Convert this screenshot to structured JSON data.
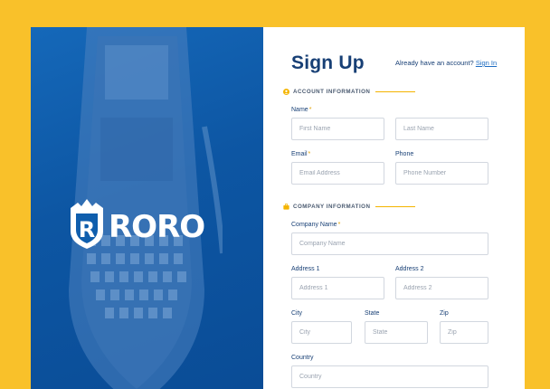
{
  "brand": {
    "name": "RORO"
  },
  "header": {
    "title": "Sign Up",
    "signin_prompt": "Already have an account?",
    "signin_link": "Sign In"
  },
  "sections": {
    "account": {
      "title": "ACCOUNT INFORMATION",
      "icon": "user-circle-icon"
    },
    "company": {
      "title": "COMPANY INFORMATION",
      "icon": "briefcase-icon"
    }
  },
  "fields": {
    "name": {
      "label": "Name",
      "required_mark": "*",
      "first_placeholder": "First Name",
      "last_placeholder": "Last Name"
    },
    "email": {
      "label": "Email",
      "required_mark": "*",
      "placeholder": "Email Address"
    },
    "phone": {
      "label": "Phone",
      "placeholder": "Phone Number"
    },
    "company_name": {
      "label": "Company Name",
      "required_mark": "*",
      "placeholder": "Company Name"
    },
    "address1": {
      "label": "Address 1",
      "placeholder": "Address 1"
    },
    "address2": {
      "label": "Address 2",
      "placeholder": "Address 2"
    },
    "city": {
      "label": "City",
      "placeholder": "City"
    },
    "state": {
      "label": "State",
      "placeholder": "State"
    },
    "zip": {
      "label": "Zip",
      "placeholder": "Zip"
    },
    "country": {
      "label": "Country",
      "placeholder": "Country"
    }
  },
  "colors": {
    "background": "#F9C12A",
    "hero_blue": "#0F5EAD",
    "heading_navy": "#173F75",
    "accent_gold": "#F4B400",
    "link_blue": "#1D6CC2"
  }
}
